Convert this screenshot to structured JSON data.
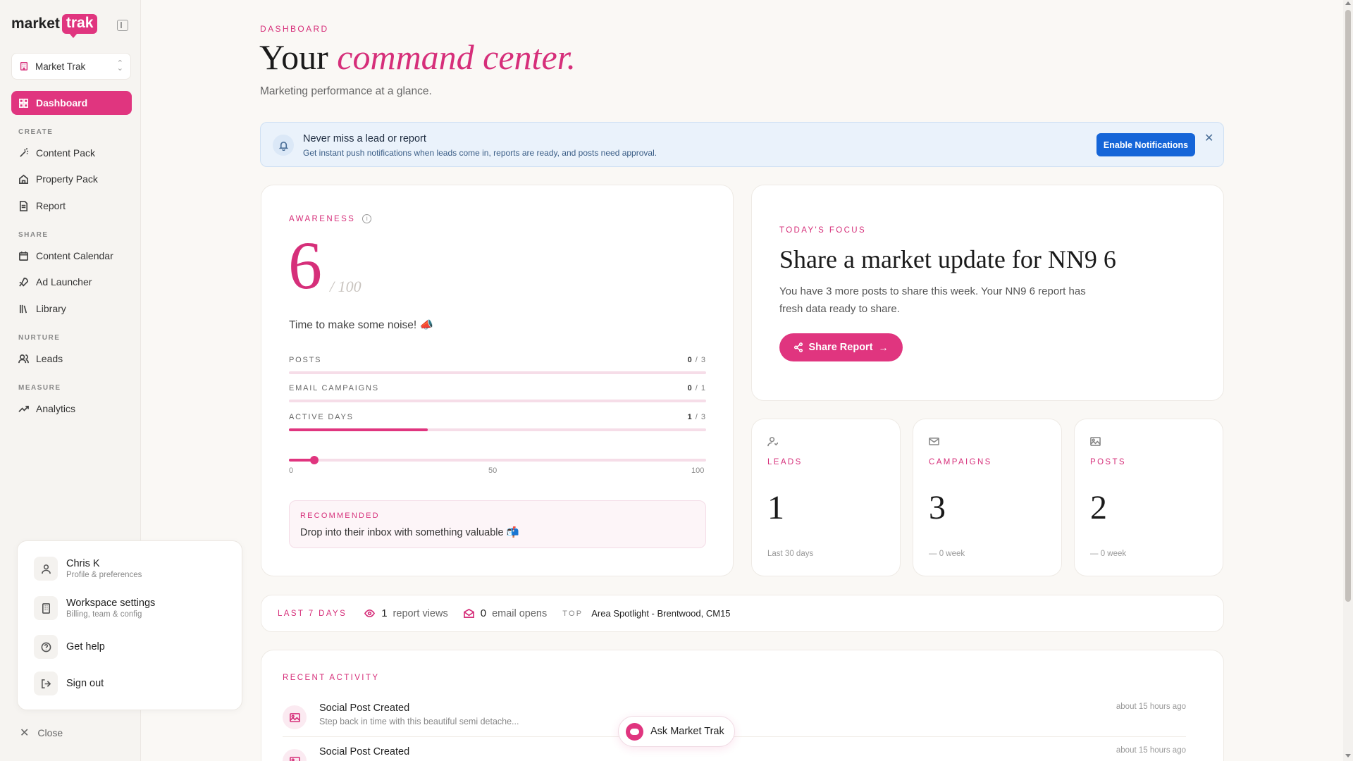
{
  "brand": {
    "logo_left": "market",
    "logo_right": "trak",
    "accent": "#e0357f",
    "notification_blue": "#1565d8"
  },
  "workspace_select": {
    "label": "Market Trak"
  },
  "nav": {
    "dashboard": "Dashboard",
    "sections": {
      "create": "CREATE",
      "share": "SHARE",
      "nurture": "NURTURE",
      "measure": "MEASURE"
    },
    "content_pack": "Content Pack",
    "property_pack": "Property Pack",
    "report": "Report",
    "content_calendar": "Content Calendar",
    "ad_launcher": "Ad Launcher",
    "library": "Library",
    "leads": "Leads",
    "analytics": "Analytics"
  },
  "profile_menu": {
    "user_name": "Chris K",
    "user_sub": "Profile & preferences",
    "workspace_title": "Workspace settings",
    "workspace_sub": "Billing, team & config",
    "help": "Get help",
    "signout": "Sign out",
    "close": "Close"
  },
  "header": {
    "crumb": "DASHBOARD",
    "title_plain": "Your ",
    "title_em": "command center.",
    "subtitle": "Marketing performance at a glance."
  },
  "notification": {
    "title": "Never miss a lead or report",
    "desc": "Get instant push notifications when leads come in, reports are ready, and posts need approval.",
    "button": "Enable Notifications"
  },
  "awareness": {
    "label": "AWARENESS",
    "score": "6",
    "max": "/ 100",
    "score_value": 6,
    "message": "Time to make some noise! 📣",
    "metrics": [
      {
        "label": "POSTS",
        "done": "0",
        "total": "/ 3",
        "fraction": 0
      },
      {
        "label": "EMAIL CAMPAIGNS",
        "done": "0",
        "total": "/ 1",
        "fraction": 0
      },
      {
        "label": "ACTIVE DAYS",
        "done": "1",
        "total": "/ 3",
        "fraction": 0.333
      }
    ],
    "ticks": [
      "0",
      "50",
      "100"
    ],
    "recommend_label": "RECOMMENDED",
    "recommend_text": "Drop into their inbox with something valuable 📬"
  },
  "focus": {
    "label": "TODAY'S FOCUS",
    "title": "Share a market update for NN9 6",
    "desc": "You have 3 more posts to share this week. Your NN9 6 report has fresh data ready to share.",
    "button": "Share Report"
  },
  "stats": [
    {
      "label": "LEADS",
      "value": "1",
      "note": "Last 30 days",
      "icon": "user-icon"
    },
    {
      "label": "CAMPAIGNS",
      "value": "3",
      "note": "— 0 week",
      "icon": "mail-icon"
    },
    {
      "label": "POSTS",
      "value": "2",
      "note": "— 0 week",
      "icon": "image-icon"
    }
  ],
  "last7": {
    "label": "LAST 7 DAYS",
    "views_num": "1",
    "views_label": "report views",
    "opens_num": "0",
    "opens_label": "email opens",
    "top_label": "TOP",
    "top_value": "Area Spotlight - Brentwood, CM15"
  },
  "activity": {
    "label": "RECENT ACTIVITY",
    "items": [
      {
        "title": "Social Post Created",
        "sub": "Step back in time with this beautiful semi detache...",
        "time": "about 15 hours ago"
      },
      {
        "title": "Social Post Created",
        "sub": "",
        "time": "about 15 hours ago"
      }
    ]
  },
  "ask": {
    "label": "Ask Market Trak"
  }
}
